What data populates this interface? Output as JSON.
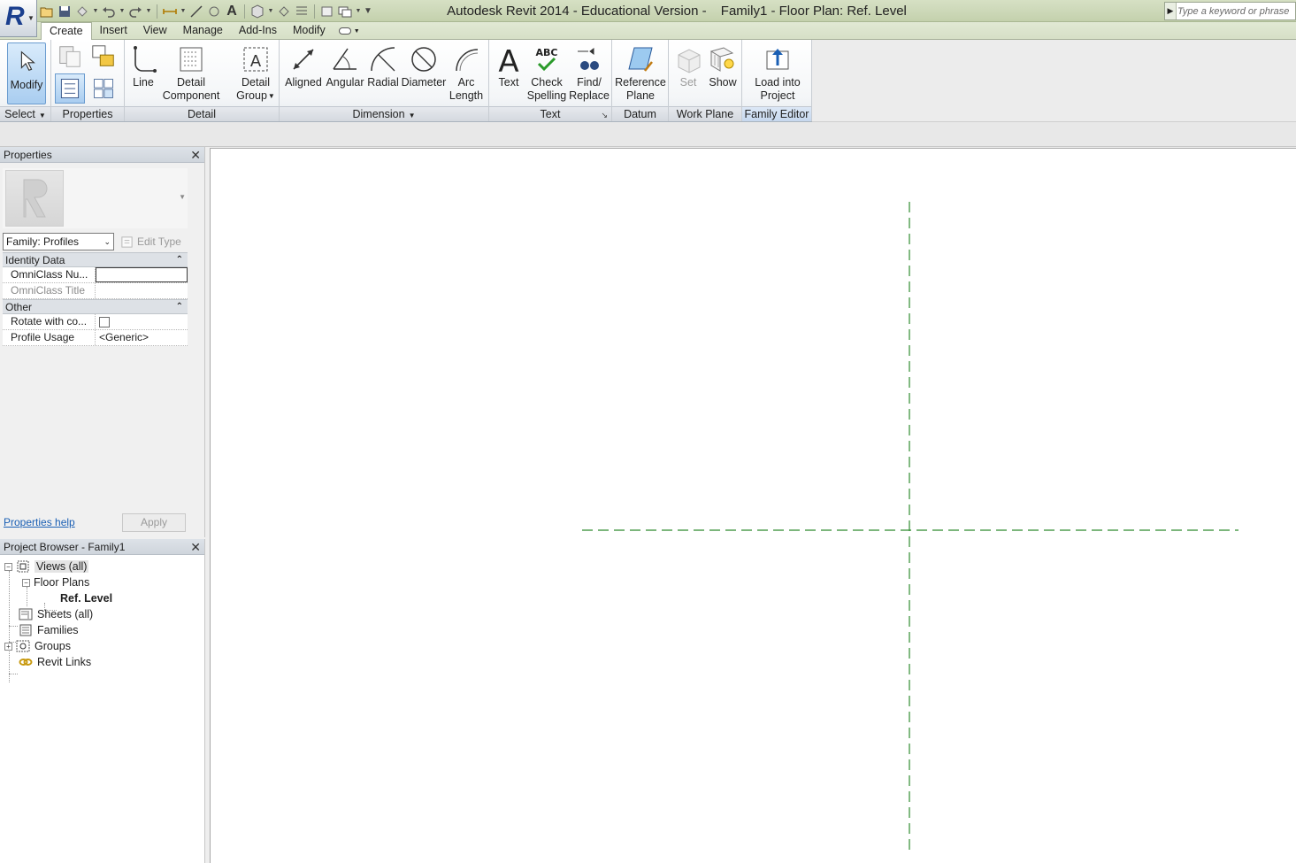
{
  "title": {
    "app": "Autodesk Revit 2014 - Educational Version -",
    "document": "Family1 - Floor Plan: Ref. Level"
  },
  "search": {
    "placeholder": "Type a keyword or phrase"
  },
  "tabs": [
    {
      "label": "Create",
      "active": true
    },
    {
      "label": "Insert"
    },
    {
      "label": "View"
    },
    {
      "label": "Manage"
    },
    {
      "label": "Add-Ins"
    },
    {
      "label": "Modify"
    }
  ],
  "ribbon": {
    "select": {
      "modify": "Modify",
      "panel": "Select"
    },
    "properties": {
      "panel": "Properties"
    },
    "detail": {
      "line": "Line",
      "detail_component_1": "Detail",
      "detail_component_2": "Component",
      "detail_group_1": "Detail",
      "detail_group_2": "Group",
      "panel": "Detail"
    },
    "dimension": {
      "aligned": "Aligned",
      "angular": "Angular",
      "radial": "Radial",
      "diameter": "Diameter",
      "arc_1": "Arc",
      "arc_2": "Length",
      "panel": "Dimension"
    },
    "text": {
      "text": "Text",
      "check_1": "Check",
      "check_2": "Spelling",
      "find_1": "Find/",
      "find_2": "Replace",
      "panel": "Text",
      "abc": "ABC"
    },
    "datum": {
      "ref_1": "Reference",
      "ref_2": "Plane",
      "panel": "Datum"
    },
    "workplane": {
      "set": "Set",
      "show": "Show",
      "panel": "Work Plane"
    },
    "family_editor": {
      "load_1": "Load into",
      "load_2": "Project",
      "panel": "Family Editor"
    }
  },
  "properties": {
    "title": "Properties",
    "family_select": "Family: Profiles",
    "edit_type": "Edit Type",
    "groups": [
      {
        "name": "Identity Data",
        "rows": [
          {
            "key": "OmniClass Nu...",
            "value": ""
          },
          {
            "key": "OmniClass Title",
            "value": ""
          }
        ]
      },
      {
        "name": "Other",
        "rows": [
          {
            "key": "Rotate with co...",
            "value": ""
          },
          {
            "key": "Profile Usage",
            "value": "<Generic>"
          }
        ]
      }
    ],
    "help": "Properties help",
    "apply": "Apply"
  },
  "browser": {
    "title": "Project Browser - Family1",
    "nodes": {
      "views": "Views (all)",
      "floor_plans": "Floor Plans",
      "ref_level": "Ref. Level",
      "sheets": "Sheets (all)",
      "families": "Families",
      "groups": "Groups",
      "links": "Revit Links"
    }
  },
  "colors": {
    "reference_plane": "#2e8b2e",
    "active_accent": "#a9cdf0"
  }
}
